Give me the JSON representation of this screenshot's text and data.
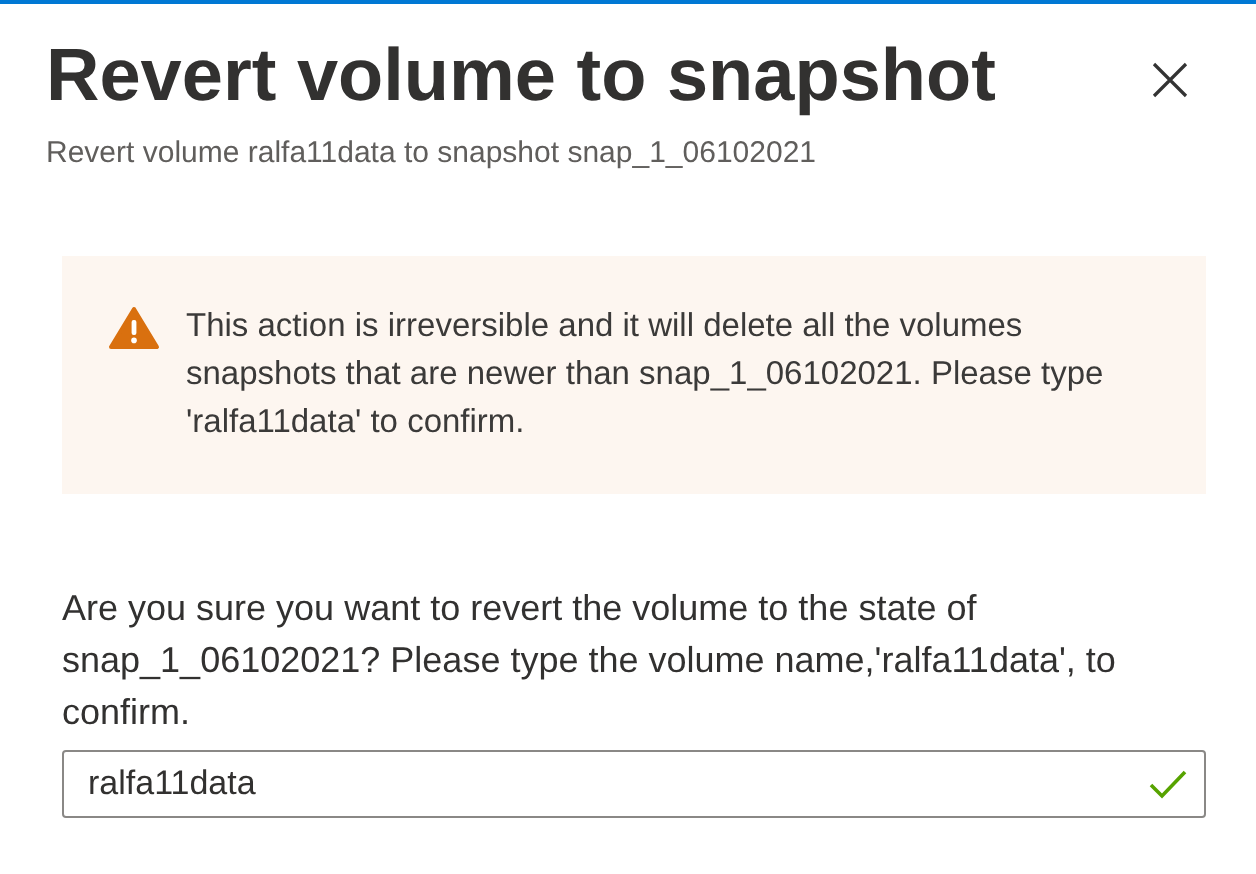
{
  "dialog": {
    "title": "Revert volume to snapshot",
    "subtitle": "Revert volume ralfa11data to snapshot snap_1_06102021"
  },
  "warning": {
    "kind": "warning",
    "text": "This action is irreversible and it will delete all the volumes snapshots that are newer than snap_1_06102021. Please type 'ralfa11data' to confirm."
  },
  "confirm": {
    "question": "Are you sure you want to revert the volume to the state of snap_1_06102021? Please type the volume name,'ralfa11data', to confirm.",
    "value": "ralfa11data",
    "valid": true
  }
}
